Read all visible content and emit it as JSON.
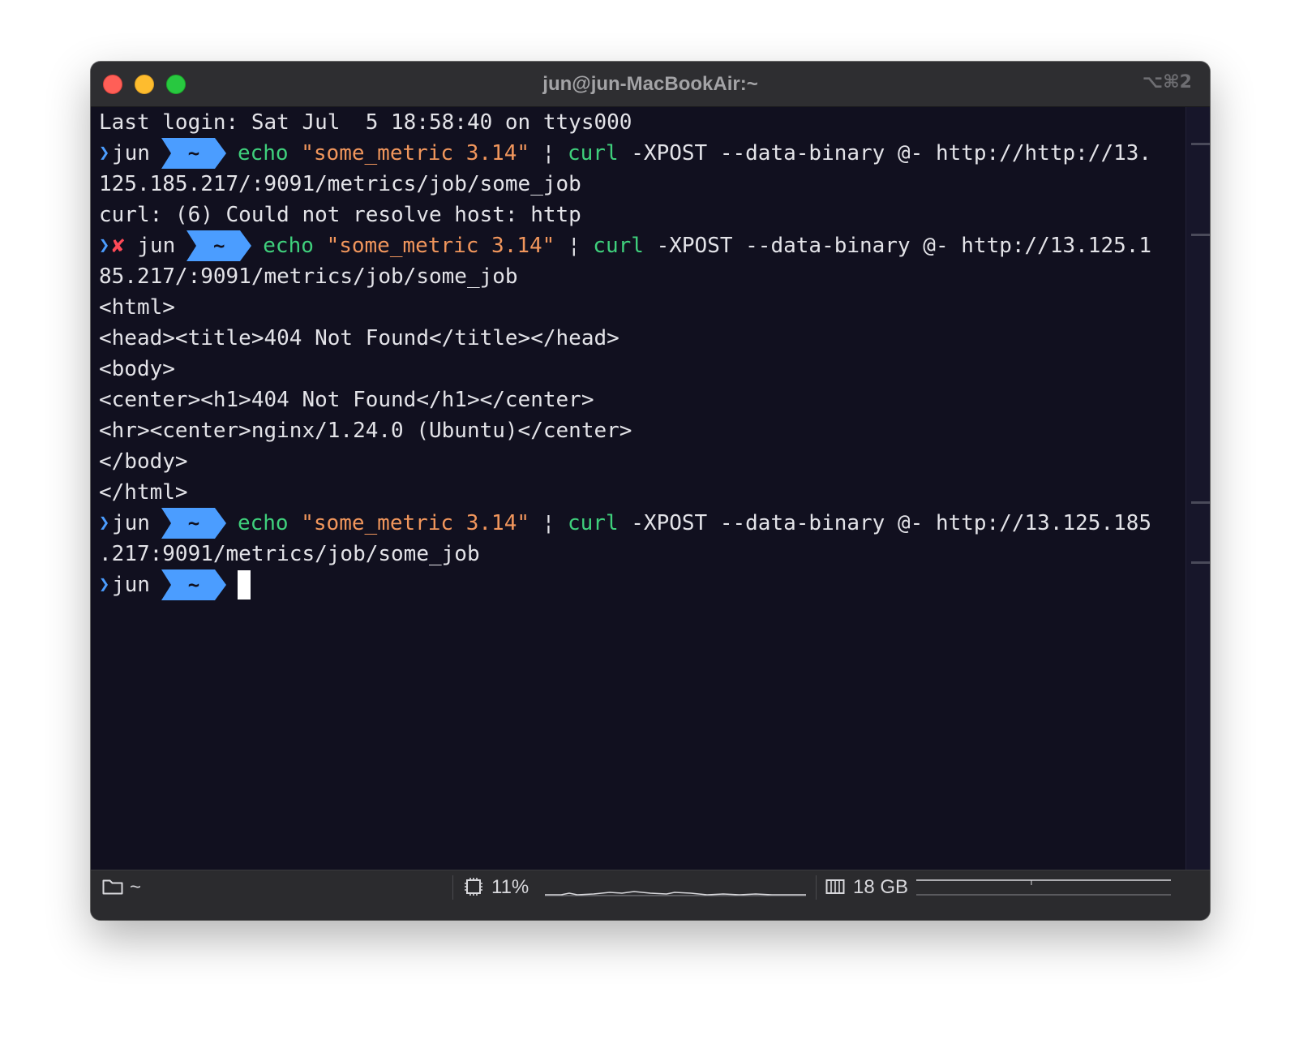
{
  "window": {
    "title": "jun@jun-MacBookAir:~",
    "shortcut": "⌥⌘2"
  },
  "prompt": {
    "user": "jun",
    "dir": "~",
    "error_mark": "✘"
  },
  "terminal": {
    "last_login": "Last login: Sat Jul  5 18:58:40 on ttys000",
    "cmd1": {
      "echo": "echo",
      "string": "\"some_metric 3.14\"",
      "pipe": "¦",
      "curl": "curl",
      "args": "-XPOST --data-binary @- http://http://13.",
      "wrap": "125.185.217/:9091/metrics/job/some_job"
    },
    "cmd1_output": "curl: (6) Could not resolve host: http",
    "cmd2": {
      "echo": "echo",
      "string": "\"some_metric 3.14\"",
      "pipe": "¦",
      "curl": "curl",
      "args": "-XPOST --data-binary @- http://13.125.1",
      "wrap": "85.217/:9091/metrics/job/some_job"
    },
    "cmd2_output": [
      "<html>",
      "<head><title>404 Not Found</title></head>",
      "<body>",
      "<center><h1>404 Not Found</h1></center>",
      "<hr><center>nginx/1.24.0 (Ubuntu)</center>",
      "</body>",
      "</html>"
    ],
    "cmd3": {
      "echo": "echo",
      "string": "\"some_metric 3.14\"",
      "pipe": "¦",
      "curl": "curl",
      "args": "-XPOST --data-binary @- http://13.125.185",
      "wrap": ".217:9091/metrics/job/some_job"
    }
  },
  "statusbar": {
    "folder_icon": "folder-icon",
    "cwd": "~",
    "cpu_icon": "cpu-chip-icon",
    "cpu": "11%",
    "memory_icon": "memory-icon",
    "memory": "18 GB"
  },
  "colors": {
    "background": "#11101f",
    "command": "#3fd07c",
    "string": "#f1965c",
    "badge": "#4b9dff",
    "error": "#ff4a57"
  }
}
